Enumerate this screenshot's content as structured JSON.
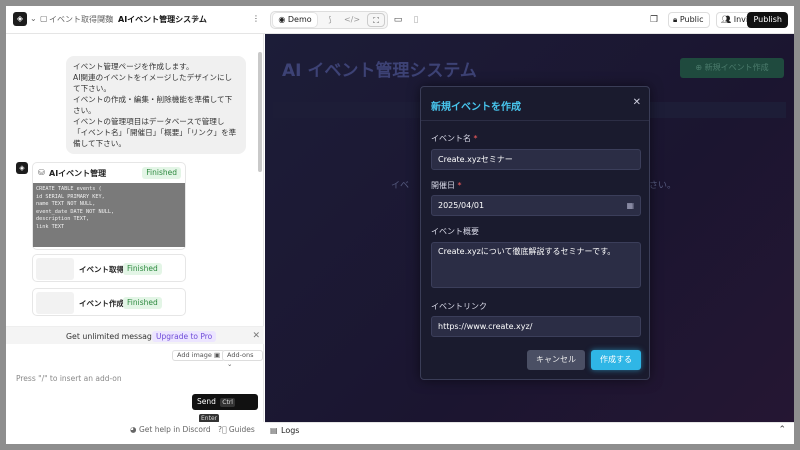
{
  "topbar": {
    "breadcrumb_parent": "イベント取得関数",
    "breadcrumb_sep": "/",
    "page_title": "AIイベント管理システム",
    "mode_label": "Demo",
    "public_label": "Public",
    "invite_label": "Invite",
    "publish_label": "Publish"
  },
  "chat": {
    "user_message": [
      "イベント管理ページを作成します。",
      "AI関連のイベントをイメージしたデザインにして下さい。",
      "イベントの作成・編集・削除機能を準備して下さい。",
      "イベントの管理項目はデータベースで管理し「イベント名」「開催日」「概要」「リンク」を準備して下さい。"
    ],
    "db_card": {
      "title": "AIイベント管理",
      "status": "Finished",
      "code": [
        "CREATE TABLE events (",
        "  id SERIAL PRIMARY KEY,",
        "  name TEXT NOT NULL,",
        "  event_date DATE NOT NULL,",
        "  description TEXT,",
        "  link TEXT"
      ]
    },
    "func_cards": [
      {
        "label": "イベント取得",
        "status": "Finished"
      },
      {
        "label": "イベント作成",
        "status": "Finished"
      }
    ],
    "upsell_text": "Get unlimited messages",
    "upgrade_label": "Upgrade to Pro",
    "add_image_label": "Add image",
    "addons_label": "Add-ons",
    "input_hint": "Press \"/\" to insert an add-on",
    "send_label": "Send",
    "send_kbd1": "Ctrl",
    "send_kbd2": "Enter",
    "discord_label": "Get help in Discord",
    "guides_label": "Guides"
  },
  "preview": {
    "bg_title": "AI イベント管理システム",
    "bg_button": "新規イベント作成",
    "bg_text_left": "イベ",
    "bg_text_right": "さい。",
    "logs_label": "Logs"
  },
  "modal": {
    "title": "新規イベントを作成",
    "name_label": "イベント名",
    "name_value": "Create.xyzセミナー",
    "date_label": "開催日",
    "date_value": "2025/04/01",
    "desc_label": "イベント概要",
    "desc_value": "Create.xyzについて徹底解説するセミナーです。",
    "link_label": "イベントリンク",
    "link_value": "https://www.create.xyz/",
    "required_mark": "*",
    "cancel_label": "キャンセル",
    "create_label": "作成する"
  },
  "colors": {
    "accent": "#2fb6e6",
    "finished_badge": "#2d8a3f",
    "upgrade": "#6e4bd8"
  }
}
